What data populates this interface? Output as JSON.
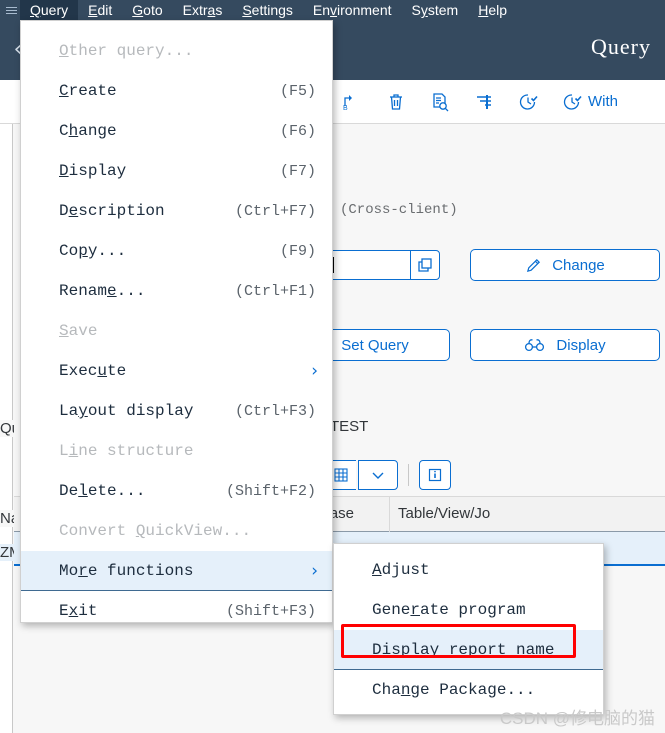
{
  "menubar": {
    "hamburger_icon": "hamburger-icon",
    "items": [
      {
        "label": "Query",
        "accel": "Q",
        "active": true
      },
      {
        "label": "Edit",
        "accel": "E",
        "active": false
      },
      {
        "label": "Goto",
        "accel": "G",
        "active": false
      },
      {
        "label": "Extras",
        "accel": "a",
        "active": false
      },
      {
        "label": "Settings",
        "accel": "S",
        "active": false
      },
      {
        "label": "Environment",
        "accel": "v",
        "active": false
      },
      {
        "label": "System",
        "accel": "y",
        "active": false
      },
      {
        "label": "Help",
        "accel": "H",
        "active": false
      }
    ]
  },
  "shellbar": {
    "back_icon": "back-chevron-icon",
    "title": "Query"
  },
  "toolbar": {
    "icons": [
      "copy-a-to-b-icon",
      "delete-trash-icon",
      "document-search-icon",
      "filter-icon",
      "clock-icon",
      "clock-with-icon"
    ],
    "with_label": "With"
  },
  "content": {
    "cross_client": "(Cross-client)",
    "query_input_value": "T",
    "value_help_icon": "value-help-icon",
    "btn_change": "Change",
    "btn_change_icon": "pencil-icon",
    "btn_display": "Display",
    "btn_display_icon": "glasses-icon",
    "btn_set_query": "Set Query",
    "test_label": "TEST",
    "subtoolbar": {
      "grid_icon": "grid-settings-icon",
      "chevron_icon": "chevron-down-icon",
      "info_icon": "info-icon"
    },
    "table": {
      "headers": [
        "",
        "",
        "Logical Database",
        "Table/View/Jo"
      ],
      "row_cells": [
        "",
        "",
        "",
        "..."
      ]
    },
    "left_strip": {
      "quick_text": "Qu",
      "name_text": "Na",
      "code_text": "ZM"
    }
  },
  "dropdown": {
    "items": [
      {
        "pre": "",
        "accel": "O",
        "post": "ther query...",
        "shortcut": "",
        "disabled": true,
        "submenu": false,
        "highlight": false
      },
      {
        "pre": "",
        "accel": "C",
        "post": "reate",
        "shortcut": "(F5)",
        "disabled": false,
        "submenu": false,
        "highlight": false
      },
      {
        "pre": "C",
        "accel": "h",
        "post": "ange",
        "shortcut": "(F6)",
        "disabled": false,
        "submenu": false,
        "highlight": false
      },
      {
        "pre": "",
        "accel": "D",
        "post": "isplay",
        "shortcut": "(F7)",
        "disabled": false,
        "submenu": false,
        "highlight": false
      },
      {
        "pre": "D",
        "accel": "e",
        "post": "scription",
        "shortcut": "(Ctrl+F7)",
        "disabled": false,
        "submenu": false,
        "highlight": false
      },
      {
        "pre": "Co",
        "accel": "p",
        "post": "y...",
        "shortcut": "(F9)",
        "disabled": false,
        "submenu": false,
        "highlight": false
      },
      {
        "pre": "Renam",
        "accel": "e",
        "post": "...",
        "shortcut": "(Ctrl+F1)",
        "disabled": false,
        "submenu": false,
        "highlight": false
      },
      {
        "pre": "",
        "accel": "S",
        "post": "ave",
        "shortcut": "",
        "disabled": true,
        "submenu": false,
        "highlight": false
      },
      {
        "pre": "Exec",
        "accel": "u",
        "post": "te",
        "shortcut": "",
        "disabled": false,
        "submenu": true,
        "highlight": false
      },
      {
        "pre": "La",
        "accel": "y",
        "post": "out display",
        "shortcut": "(Ctrl+F3)",
        "disabled": false,
        "submenu": false,
        "highlight": false
      },
      {
        "pre": "L",
        "accel": "i",
        "post": "ne structure",
        "shortcut": "",
        "disabled": true,
        "submenu": false,
        "highlight": false
      },
      {
        "pre": "De",
        "accel": "l",
        "post": "ete...",
        "shortcut": "(Shift+F2)",
        "disabled": false,
        "submenu": false,
        "highlight": false
      },
      {
        "pre": "Convert ",
        "accel": "Q",
        "post": "uickView...",
        "shortcut": "",
        "disabled": true,
        "submenu": false,
        "highlight": false
      },
      {
        "pre": "Mo",
        "accel": "r",
        "post": "e functions",
        "shortcut": "",
        "disabled": false,
        "submenu": true,
        "highlight": true
      },
      {
        "pre": "E",
        "accel": "x",
        "post": "it",
        "shortcut": "(Shift+F3)",
        "disabled": false,
        "submenu": false,
        "highlight": false
      }
    ]
  },
  "submenu": {
    "items": [
      {
        "pre": "",
        "accel": "A",
        "post": "djust",
        "highlight": false
      },
      {
        "pre": "Gene",
        "accel": "r",
        "post": "ate program",
        "highlight": false
      },
      {
        "pre": "Display r",
        "accel": "e",
        "post": "port name",
        "highlight": true
      },
      {
        "pre": "Cha",
        "accel": "n",
        "post": "ge Package...",
        "highlight": false
      }
    ]
  },
  "annotation": {
    "highlight_color": "#ff0000",
    "target_label": "Display report name"
  },
  "watermark": {
    "text": "CSDN @修电脑的猫"
  }
}
